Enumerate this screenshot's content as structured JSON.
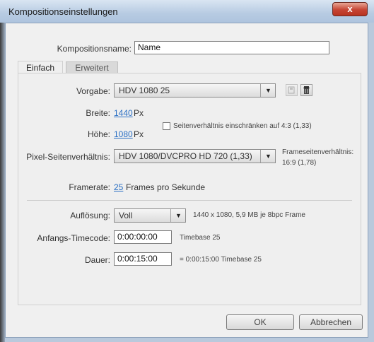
{
  "window": {
    "title": "Kompositionseinstellungen",
    "close_glyph": "x"
  },
  "name": {
    "label": "Kompositionsname:",
    "value": "Name"
  },
  "tabs": [
    {
      "label": "Einfach",
      "active": true
    },
    {
      "label": "Erweitert",
      "active": false
    }
  ],
  "preset": {
    "label": "Vorgabe:",
    "value": "HDV 1080 25",
    "icons": [
      "save-preset-icon",
      "trash-icon"
    ]
  },
  "width": {
    "label": "Breite:",
    "value": "1440",
    "unit": "Px"
  },
  "height": {
    "label": "Höhe:",
    "value": "1080",
    "unit": "Px"
  },
  "aspect_lock": {
    "label": "Seitenverhältnis einschränken auf 4:3 (1,33)",
    "checked": false
  },
  "pixel_aspect": {
    "label": "Pixel-Seitenverhältnis:",
    "value": "HDV 1080/DVCPRO HD 720 (1,33)",
    "frame_aspect_label": "Frameseitenverhältnis:",
    "frame_aspect_value": "16:9 (1,78)"
  },
  "framerate": {
    "label": "Framerate:",
    "value": "25",
    "unit": "Frames pro Sekunde"
  },
  "resolution": {
    "label": "Auflösung:",
    "value": "Voll",
    "info": "1440 x 1080, 5,9 MB je 8bpc Frame"
  },
  "start_timecode": {
    "label": "Anfangs-Timecode:",
    "value": "0:00:00:00",
    "info": "Timebase 25"
  },
  "duration": {
    "label": "Dauer:",
    "value": "0:00:15:00",
    "info": "= 0:00:15:00  Timebase 25"
  },
  "buttons": {
    "ok": "OK",
    "cancel": "Abbrechen"
  },
  "colors": {
    "link": "#2a6fc4",
    "close": "#c64433",
    "titlebar": "#b7cbe2"
  }
}
